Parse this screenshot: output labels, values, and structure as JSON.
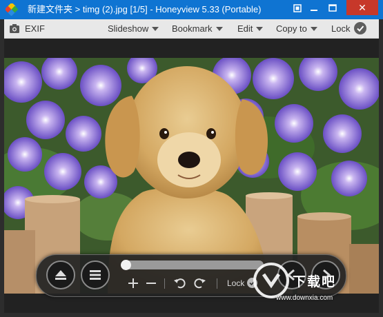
{
  "window": {
    "title": "新建文件夹 > timg (2).jpg [1/5] - Honeyview 5.33 (Portable)",
    "buttons": {
      "minimize": "▬",
      "maximize": "☐",
      "close": "✕"
    }
  },
  "toolbar": {
    "exif_label": "EXIF",
    "slideshow_label": "Slideshow",
    "bookmark_label": "Bookmark",
    "edit_label": "Edit",
    "copy_to_label": "Copy to",
    "lock_label": "Lock"
  },
  "viewer": {
    "image_subject": "golden retriever puppy sitting among purple petunias on wooden fence posts"
  },
  "controls": {
    "progress_position": 0.0,
    "zoom_in": "+",
    "zoom_out": "−",
    "lock_label": "Lock",
    "icons": [
      "eject-icon",
      "menu-icon",
      "plus-icon",
      "minus-icon",
      "rotate-left-icon",
      "rotate-right-icon",
      "previous-icon",
      "next-icon"
    ]
  },
  "watermark": {
    "text": "下载吧",
    "url": "www.downxia.com"
  },
  "colors": {
    "titlebar": "#0f74d2",
    "close": "#c7382a",
    "toolbar": "#e8e8e8"
  }
}
